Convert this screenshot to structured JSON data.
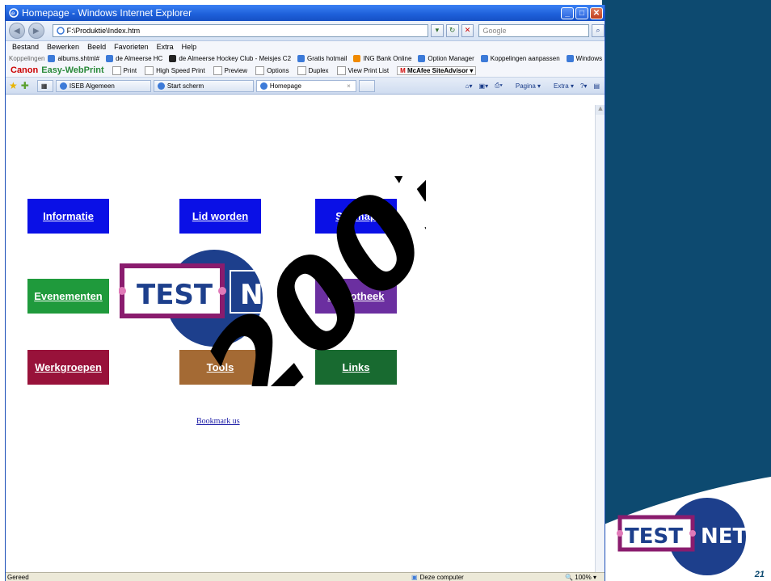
{
  "colors": {
    "slide_blue": "#0d4a70",
    "informatie": "#0a10e6",
    "lid_worden": "#0a10e6",
    "sitemap": "#0a10e6",
    "evenementen": "#1f9a3c",
    "bibliotheek": "#6b2fa0",
    "werkgroepen": "#98123a",
    "tools": "#a46a34",
    "links": "#186a30"
  },
  "window": {
    "title": "Homepage - Windows Internet Explorer",
    "address": "F:\\Produktie\\Index.htm",
    "search_placeholder": "Google"
  },
  "menu": [
    "Bestand",
    "Bewerken",
    "Beeld",
    "Favorieten",
    "Extra",
    "Help"
  ],
  "links_bar": {
    "label": "Koppelingen",
    "items": [
      "albums.shtml#",
      "de Almeerse HC",
      "de Almeerse Hockey Club - Meisjes C2",
      "Gratis hotmail",
      "ING Bank Online",
      "Option Manager",
      "Koppelingen aanpassen",
      "Windows"
    ]
  },
  "canon_bar": {
    "brand": "Canon",
    "product": "Easy-WebPrint",
    "items": [
      "Print",
      "High Speed Print",
      "Preview",
      "Options",
      "Duplex",
      "View Print List"
    ],
    "mcafee": "McAfee SiteAdvisor"
  },
  "tabs": [
    "ISEB Algemeen",
    "Start scherm",
    "Homepage"
  ],
  "command_bar": [
    "Pagina",
    "Extra"
  ],
  "page": {
    "nav": {
      "informatie": "Informatie",
      "lid_worden": "Lid worden",
      "sitemap": "Sitemap",
      "evenementen": "Evenementen",
      "bibliotheek": "Bibliotheek",
      "werkgroepen": "Werkgroepen",
      "tools": "Tools",
      "links": "Links"
    },
    "bookmark": "Bookmark us",
    "year": "2003",
    "logo_text_left": "TEST",
    "logo_text_right": "NET"
  },
  "status": {
    "left": "Gereed",
    "zone": "Deze computer",
    "zoom": "100%"
  },
  "slide": {
    "number": "21",
    "logo_left": "TEST",
    "logo_right": "NET"
  }
}
